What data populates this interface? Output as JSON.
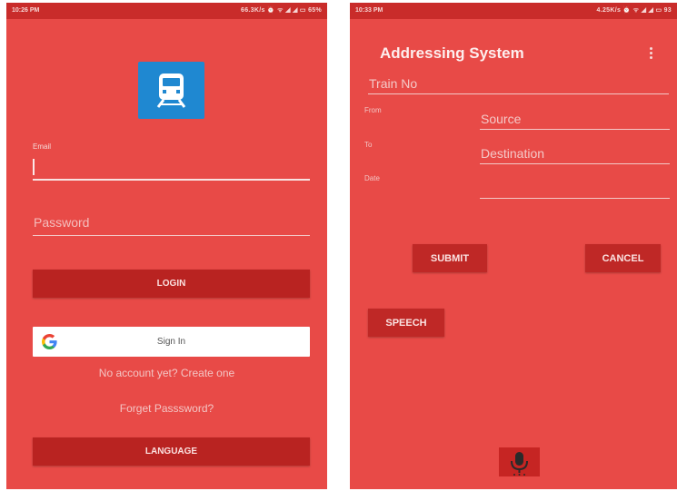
{
  "left_screen": {
    "status": {
      "time": "10:26 PM",
      "right": "66.3K/s ⏰ ᯤ ◢ ◢ ▭ 65%"
    },
    "logo": {
      "icon": "train-icon",
      "color": "#1f88d1"
    },
    "email": {
      "label": "Email",
      "value": ""
    },
    "password": {
      "placeholder": "Password"
    },
    "login_label": "LOGIN",
    "google": {
      "icon": "google-g-icon",
      "label": "Sign In"
    },
    "create_account_text": "No account yet? Create one",
    "forget_password_text": "Forget Passsword?",
    "language_label": "LANGUAGE"
  },
  "right_screen": {
    "status": {
      "time": "10:33 PM",
      "right": "4.25K/s ⏰ ᯤ ◢ ◢ ▭ 93"
    },
    "title": "Addressing System",
    "train_no_placeholder": "Train No",
    "from_label": "From",
    "source_placeholder": "Source",
    "to_label": "To",
    "destination_placeholder": "Destination",
    "date_label": "Date",
    "date_value": "",
    "submit_label": "SUBMIT",
    "cancel_label": "CANCEL",
    "speech_label": "SPEECH",
    "mic_icon": "microphone-icon"
  },
  "colors": {
    "screen_bg": "#e84a47",
    "status_bar": "#c92c2a",
    "button_dark": "#b92321",
    "google_button": "#ffffff",
    "logo_blue": "#1f88d1"
  }
}
